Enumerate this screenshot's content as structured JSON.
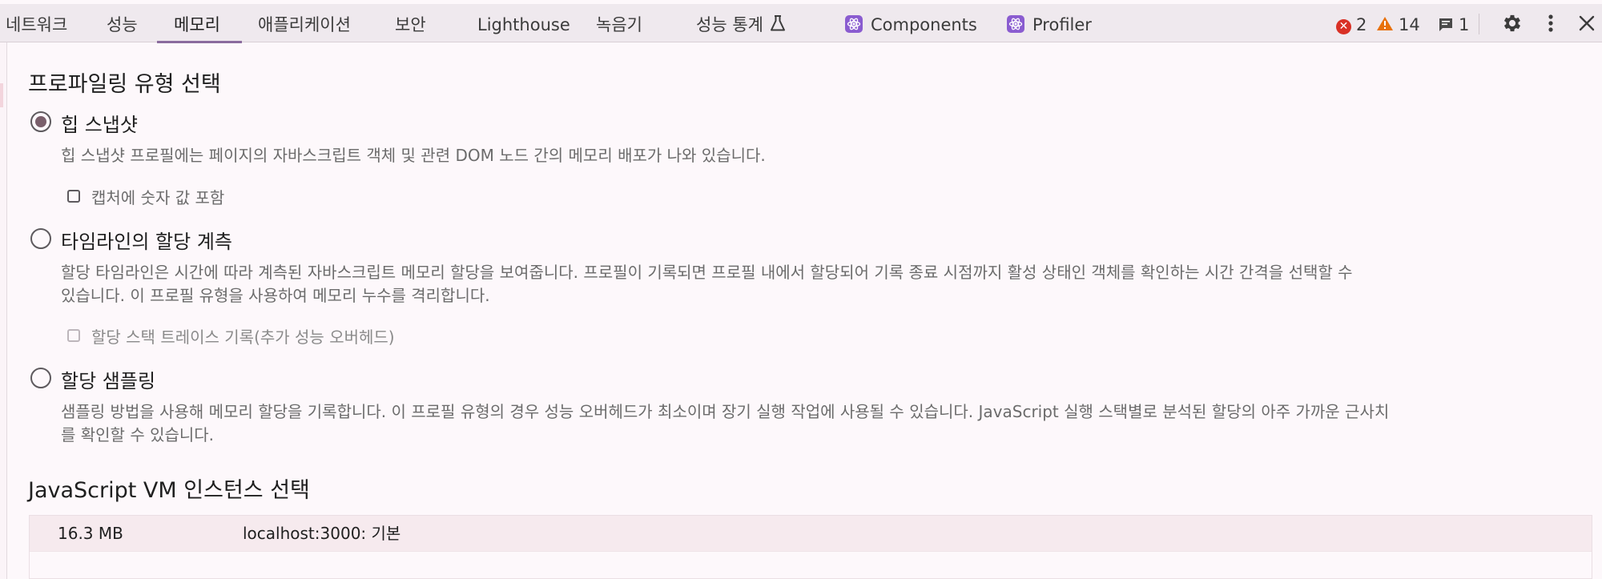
{
  "tabs": [
    {
      "label": "네트워크",
      "selected": false
    },
    {
      "label": "성능",
      "selected": false
    },
    {
      "label": "메모리",
      "selected": true
    },
    {
      "label": "애플리케이션",
      "selected": false
    },
    {
      "label": "보안",
      "selected": false
    },
    {
      "label": "Lighthouse",
      "selected": false
    },
    {
      "label": "녹음기",
      "selected": false
    },
    {
      "label": "성능 통계",
      "selected": false,
      "icon": "flask-icon"
    },
    {
      "label": "Components",
      "selected": false,
      "icon": "react-icon"
    },
    {
      "label": "Profiler",
      "selected": false,
      "icon": "react-icon"
    }
  ],
  "status": {
    "errors": "2",
    "warnings": "14",
    "messages": "1"
  },
  "toolbar_icons": [
    "settings-icon",
    "more-vertical-icon",
    "close-icon"
  ],
  "colors": {
    "accent": "#8a6b9e",
    "error": "#d93025",
    "warning": "#e8710a",
    "react": "#8a5cd0"
  },
  "profiling": {
    "heading": "프로파일링 유형 선택",
    "options": [
      {
        "label": "힙 스냅샷",
        "checked": true,
        "description": "힙 스냅샷 프로필에는 페이지의 자바스크립트 객체 및 관련 DOM 노드 간의 메모리 배포가 나와 있습니다.",
        "checkbox": {
          "label": "캡처에 숫자 값 포함",
          "checked": false,
          "disabled": false
        }
      },
      {
        "label": "타임라인의 할당 계측",
        "checked": false,
        "description_lines": [
          "할당 타임라인은 시간에 따라 계측된 자바스크립트 메모리 할당을 보여줍니다. 프로필이 기록되면 프로필 내에서 할당되어 기록 종료 시점까지 활성 상태인 객체를 확인하는 시간 간격을 선택할 수",
          "있습니다. 이 프로필 유형을 사용하여 메모리 누수를 격리합니다."
        ],
        "checkbox": {
          "label": "할당 스택 트레이스 기록(추가 성능 오버헤드)",
          "checked": false,
          "disabled": true
        }
      },
      {
        "label": "할당 샘플링",
        "checked": false,
        "description_lines": [
          "샘플링 방법을 사용해 메모리 할당을 기록합니다. 이 프로필 유형의 경우 성능 오버헤드가 최소이며 장기 실행 작업에 사용될 수 있습니다. JavaScript 실행 스택별로 분석된 할당의 아주 가까운 근사치",
          "를 확인할 수 있습니다."
        ]
      }
    ]
  },
  "vm": {
    "heading": "JavaScript VM 인스턴스 선택",
    "instances": [
      {
        "size": "16.3 MB",
        "name": "localhost:3000: 기본"
      }
    ]
  }
}
